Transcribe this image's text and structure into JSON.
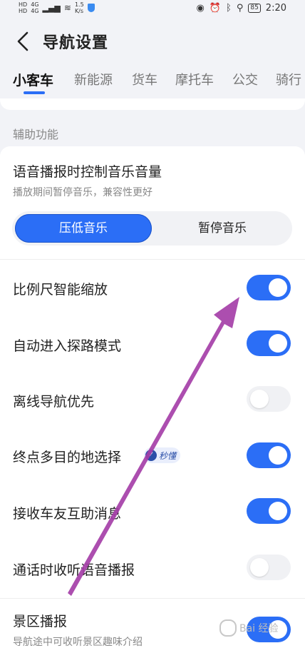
{
  "status_bar": {
    "net_hd1": "HD",
    "net_hd2": "HD",
    "net_4g1": "4G",
    "net_4g2": "4G",
    "speed_value": "1.5",
    "speed_unit": "K/s",
    "battery": "85",
    "time": "2:20"
  },
  "header": {
    "title": "导航设置"
  },
  "tabs": [
    {
      "label": "小客车"
    },
    {
      "label": "新能源"
    },
    {
      "label": "货车"
    },
    {
      "label": "摩托车"
    },
    {
      "label": "公交"
    },
    {
      "label": "骑行"
    }
  ],
  "section": {
    "label": "辅助功能"
  },
  "voice_music": {
    "title": "语音播报时控制音乐音量",
    "subtitle": "播放期间暂停音乐，兼容性更好",
    "option_selected": "压低音乐",
    "option_other": "暂停音乐"
  },
  "settings": [
    {
      "label": "比例尺智能缩放",
      "on": true
    },
    {
      "label": "自动进入探路模式",
      "on": true
    },
    {
      "label": "离线导航优先",
      "on": false
    },
    {
      "label": "终点多目的地选择",
      "on": true
    },
    {
      "label": "接收车友互助消息",
      "on": true
    },
    {
      "label": "通话时收听语音播报",
      "on": false
    },
    {
      "label": "景区播报",
      "on": true
    }
  ],
  "badge": {
    "icon_text": "✓",
    "text": "秒懂"
  },
  "scenic": {
    "subtitle": "导航途中可收听景区趣味介绍"
  },
  "watermark": {
    "text": "Bai 经验"
  },
  "colors": {
    "accent": "#2b6ef6",
    "annotation_arrow": "#a53fa8"
  }
}
